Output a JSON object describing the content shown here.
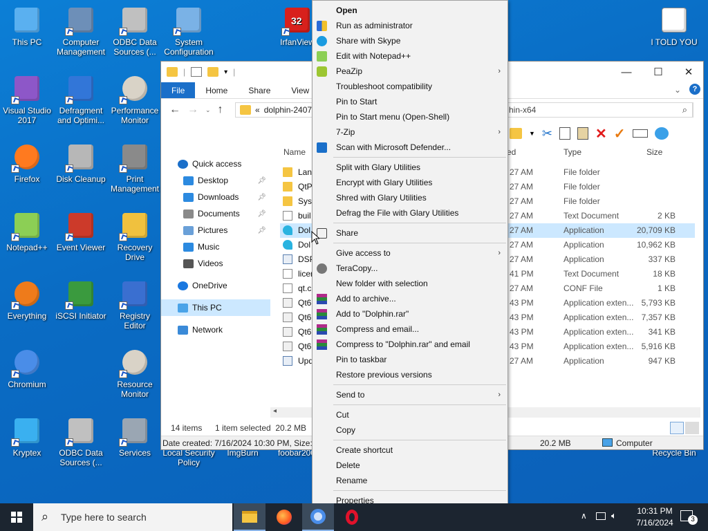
{
  "desktop_icons": [
    {
      "label": "This PC",
      "icon": "pc-icon",
      "x": 0,
      "y": 0
    },
    {
      "label": "Computer Management",
      "icon": "computer-management-icon"
    },
    {
      "label": "ODBC Data Sources (...",
      "icon": "odbc-icon"
    },
    {
      "label": "System Configuration",
      "icon": "system-config-icon"
    },
    {
      "label": "IrfanView",
      "icon": "irfanview-icon"
    },
    {
      "label": "I TOLD YOU",
      "icon": "text-file-icon"
    },
    {
      "label": "Visual Studio 2017",
      "icon": "visual-studio-icon"
    },
    {
      "label": "Defragment and Optimi...",
      "icon": "defrag-icon"
    },
    {
      "label": "Performance Monitor",
      "icon": "performance-monitor-icon"
    },
    {
      "label": "Firefox",
      "icon": "firefox-icon"
    },
    {
      "label": "Disk Cleanup",
      "icon": "disk-cleanup-icon"
    },
    {
      "label": "Print Management",
      "icon": "print-management-icon"
    },
    {
      "label": "Notepad++",
      "icon": "notepadpp-icon"
    },
    {
      "label": "Event Viewer",
      "icon": "event-viewer-icon"
    },
    {
      "label": "Recovery Drive",
      "icon": "recovery-drive-icon"
    },
    {
      "label": "Everything",
      "icon": "everything-icon"
    },
    {
      "label": "iSCSI Initiator",
      "icon": "iscsi-icon"
    },
    {
      "label": "Registry Editor",
      "icon": "registry-icon"
    },
    {
      "label": "Chromium",
      "icon": "chromium-icon"
    },
    {
      "label": "Resource Monitor",
      "icon": "resource-monitor-icon"
    },
    {
      "label": "Kryptex",
      "icon": "kryptex-icon"
    },
    {
      "label": "ODBC Data Sources (...",
      "icon": "odbc-icon"
    },
    {
      "label": "Services",
      "icon": "services-icon"
    },
    {
      "label": "Local Security Policy",
      "icon": "security-policy-icon"
    },
    {
      "label": "ImgBurn",
      "icon": "imgburn-icon"
    },
    {
      "label": "foobar200",
      "icon": "foobar-icon"
    },
    {
      "label": "Recycle Bin",
      "icon": "recycle-bin-icon"
    }
  ],
  "irfanview_badge": "32",
  "explorer": {
    "ribbon_tabs": [
      "File",
      "Home",
      "Share",
      "View"
    ],
    "address": "dolphin-2407-",
    "address_chevron": "«",
    "search_text": "hin-x64",
    "nav": [
      {
        "label": "Quick access",
        "icon": "star-icon",
        "sub": false
      },
      {
        "label": "Desktop",
        "icon": "desktop-icon",
        "sub": true,
        "pin": true
      },
      {
        "label": "Downloads",
        "icon": "download-icon",
        "sub": true,
        "pin": true
      },
      {
        "label": "Documents",
        "icon": "documents-icon",
        "sub": true,
        "pin": true
      },
      {
        "label": "Pictures",
        "icon": "pictures-icon",
        "sub": true,
        "pin": true
      },
      {
        "label": "Music",
        "icon": "music-icon",
        "sub": true,
        "pin": false
      },
      {
        "label": "Videos",
        "icon": "videos-icon",
        "sub": true,
        "pin": false
      },
      {
        "label": "OneDrive",
        "icon": "onedrive-icon",
        "sub": false
      },
      {
        "label": "This PC",
        "icon": "pc-icon",
        "sub": false,
        "selected": true
      },
      {
        "label": "Network",
        "icon": "network-icon",
        "sub": false
      }
    ],
    "columns": {
      "name": "Name",
      "modified": "ed",
      "type": "Type",
      "size": "Size"
    },
    "rows": [
      {
        "name": "Lang",
        "time": "27 AM",
        "type": "File folder",
        "size": "",
        "kind": "folder"
      },
      {
        "name": "QtP",
        "time": "27 AM",
        "type": "File folder",
        "size": "",
        "kind": "folder"
      },
      {
        "name": "Sys",
        "time": "27 AM",
        "type": "File folder",
        "size": "",
        "kind": "folder"
      },
      {
        "name": "buil",
        "time": "27 AM",
        "type": "Text Document",
        "size": "2 KB",
        "kind": "doc"
      },
      {
        "name": "Dol",
        "time": "27 AM",
        "type": "Application",
        "size": "20,709 KB",
        "kind": "app",
        "selected": true
      },
      {
        "name": "Dol",
        "time": "27 AM",
        "type": "Application",
        "size": "10,962 KB",
        "kind": "app"
      },
      {
        "name": "DSP",
        "time": "27 AM",
        "type": "Application",
        "size": "337 KB",
        "kind": "exe"
      },
      {
        "name": "licer",
        "time": "41 PM",
        "type": "Text Document",
        "size": "18 KB",
        "kind": "doc"
      },
      {
        "name": "qt.c",
        "time": "27 AM",
        "type": "CONF File",
        "size": "1 KB",
        "kind": "doc"
      },
      {
        "name": "Qt6",
        "time": "43 PM",
        "type": "Application exten...",
        "size": "5,793 KB",
        "kind": "dll"
      },
      {
        "name": "Qt6",
        "time": "43 PM",
        "type": "Application exten...",
        "size": "7,357 KB",
        "kind": "dll"
      },
      {
        "name": "Qt6",
        "time": "43 PM",
        "type": "Application exten...",
        "size": "341 KB",
        "kind": "dll"
      },
      {
        "name": "Qt6",
        "time": "43 PM",
        "type": "Application exten...",
        "size": "5,916 KB",
        "kind": "dll"
      },
      {
        "name": "Upd",
        "time": "27 AM",
        "type": "Application",
        "size": "947 KB",
        "kind": "exe"
      }
    ],
    "status": {
      "items": "14 items",
      "selected": "1 item selected  20.2 MB",
      "details": "Date created: 7/16/2024 10:30 PM, Size: 20",
      "size": "20.2 MB",
      "location": "Computer"
    }
  },
  "context_menu": [
    {
      "label": "Open",
      "bold": true
    },
    {
      "label": "Run as administrator",
      "icon": "shield-icon"
    },
    {
      "label": "Share with Skype",
      "icon": "skype-icon"
    },
    {
      "label": "Edit with Notepad++",
      "icon": "notepadpp-icon"
    },
    {
      "label": "PeaZip",
      "icon": "peazip-icon",
      "sub": true
    },
    {
      "label": "Troubleshoot compatibility"
    },
    {
      "label": "Pin to Start"
    },
    {
      "label": "Pin to Start menu (Open-Shell)"
    },
    {
      "label": "7-Zip",
      "sub": true
    },
    {
      "label": "Scan with Microsoft Defender...",
      "icon": "defender-icon"
    },
    {
      "sep": true
    },
    {
      "label": "Split with Glary Utilities"
    },
    {
      "label": "Encrypt with Glary Utilities"
    },
    {
      "label": "Shred with Glary Utilities"
    },
    {
      "label": "Defrag the File with Glary Utilities"
    },
    {
      "sep": true
    },
    {
      "label": "Share",
      "icon": "share-icon"
    },
    {
      "sep": true
    },
    {
      "label": "Give access to",
      "sub": true
    },
    {
      "label": "TeraCopy...",
      "icon": "teracopy-icon"
    },
    {
      "label": "New folder with selection"
    },
    {
      "label": "Add to archive...",
      "icon": "winrar-icon"
    },
    {
      "label": "Add to \"Dolphin.rar\"",
      "icon": "winrar-icon"
    },
    {
      "label": "Compress and email...",
      "icon": "winrar-icon"
    },
    {
      "label": "Compress to \"Dolphin.rar\" and email",
      "icon": "winrar-icon"
    },
    {
      "label": "Pin to taskbar"
    },
    {
      "label": "Restore previous versions"
    },
    {
      "sep": true
    },
    {
      "label": "Send to",
      "sub": true
    },
    {
      "sep": true
    },
    {
      "label": "Cut"
    },
    {
      "label": "Copy"
    },
    {
      "sep": true
    },
    {
      "label": "Create shortcut"
    },
    {
      "label": "Delete"
    },
    {
      "label": "Rename"
    },
    {
      "sep": true
    },
    {
      "label": "Properties"
    }
  ],
  "taskbar": {
    "search_placeholder": "Type here to search",
    "time": "10:31 PM",
    "date": "7/16/2024",
    "notifications": "3"
  },
  "colors": {
    "accent": "#1a6fc9",
    "desktop": "#0a6cc4",
    "selection": "#cce8ff"
  }
}
